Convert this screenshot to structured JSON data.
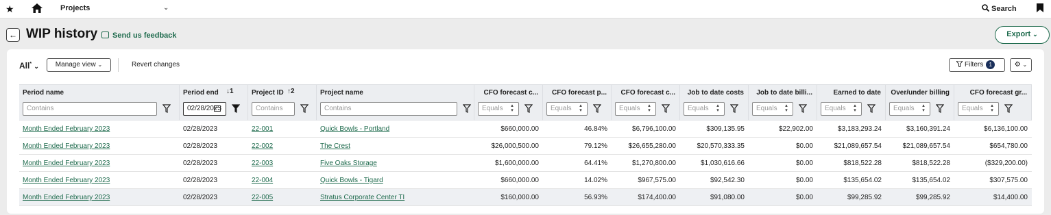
{
  "topbar": {
    "project_label": "Projects",
    "search_label": "Search"
  },
  "header": {
    "title": "WIP history",
    "feedback": "Send us feedback",
    "export": "Export"
  },
  "toolbar": {
    "view_label": "All",
    "manage_view": "Manage view",
    "revert": "Revert changes",
    "filters": "Filters",
    "filters_count": "1"
  },
  "columns": [
    {
      "label": "Period name",
      "sort": "",
      "filter": "Contains"
    },
    {
      "label": "Period end",
      "sort": "1",
      "filter": "02/28/2023"
    },
    {
      "label": "Project ID",
      "sort": "2",
      "filter": "Contains"
    },
    {
      "label": "Project name",
      "sort": "",
      "filter": "Contains"
    },
    {
      "label": "CFO forecast c...",
      "sort": "",
      "filter": "Equals"
    },
    {
      "label": "CFO forecast p...",
      "sort": "",
      "filter": "Equals"
    },
    {
      "label": "CFO forecast c...",
      "sort": "",
      "filter": "Equals"
    },
    {
      "label": "Job to date costs",
      "sort": "",
      "filter": "Equals"
    },
    {
      "label": "Job to date billi...",
      "sort": "",
      "filter": "Equals"
    },
    {
      "label": "Earned to date",
      "sort": "",
      "filter": "Equals"
    },
    {
      "label": "Over/under billing",
      "sort": "",
      "filter": "Equals"
    },
    {
      "label": "CFO forecast gr...",
      "sort": "",
      "filter": "Equals"
    }
  ],
  "rows": [
    [
      "Month Ended February 2023",
      "02/28/2023",
      "22-001",
      "Quick Bowls - Portland",
      "$660,000.00",
      "46.84%",
      "$6,796,100.00",
      "$309,135.95",
      "$22,902.00",
      "$3,183,293.24",
      "$3,160,391.24",
      "$6,136,100.00"
    ],
    [
      "Month Ended February 2023",
      "02/28/2023",
      "22-002",
      "The Crest",
      "$26,000,500.00",
      "79.12%",
      "$26,655,280.00",
      "$20,570,333.35",
      "$0.00",
      "$21,089,657.54",
      "$21,089,657.54",
      "$654,780.00"
    ],
    [
      "Month Ended February 2023",
      "02/28/2023",
      "22-003",
      "Five Oaks Storage",
      "$1,600,000.00",
      "64.41%",
      "$1,270,800.00",
      "$1,030,616.66",
      "$0.00",
      "$818,522.28",
      "$818,522.28",
      "($329,200.00)"
    ],
    [
      "Month Ended February 2023",
      "02/28/2023",
      "22-004",
      "Quick Bowls - Tigard",
      "$660,000.00",
      "14.02%",
      "$967,575.00",
      "$92,542.30",
      "$0.00",
      "$135,654.02",
      "$135,654.02",
      "$307,575.00"
    ],
    [
      "Month Ended February 2023",
      "02/28/2023",
      "22-005",
      "Stratus Corporate Center TI",
      "$160,000.00",
      "56.93%",
      "$174,400.00",
      "$91,080.00",
      "$0.00",
      "$99,285.92",
      "$99,285.92",
      "$14,400.00"
    ]
  ]
}
